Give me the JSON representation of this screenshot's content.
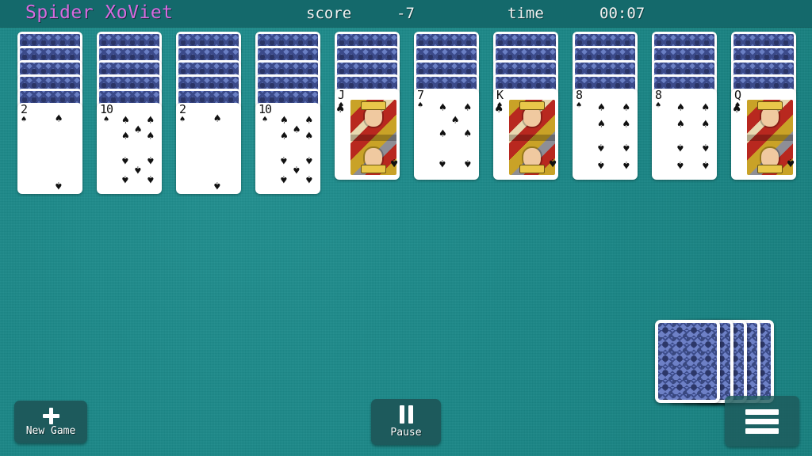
{
  "header": {
    "title": "Spider XoViet",
    "score_label": "score",
    "score_value": "-7",
    "time_label": "time",
    "time_value": "00:07"
  },
  "theme": {
    "felt_color": "#1b8a8a",
    "header_color": "#14696b",
    "title_color": "#d96ae0",
    "button_color": "#1d5a5c",
    "card_back_color": "#6d80c6"
  },
  "tableau": {
    "columns": [
      {
        "index": 1,
        "facedown_count": 5,
        "faceup": {
          "rank": "2",
          "suit": "♠",
          "pip_count": 2,
          "is_court": false
        }
      },
      {
        "index": 2,
        "facedown_count": 5,
        "faceup": {
          "rank": "10",
          "suit": "♠",
          "pip_count": 10,
          "is_court": false
        }
      },
      {
        "index": 3,
        "facedown_count": 5,
        "faceup": {
          "rank": "2",
          "suit": "♠",
          "pip_count": 2,
          "is_court": false
        }
      },
      {
        "index": 4,
        "facedown_count": 5,
        "faceup": {
          "rank": "10",
          "suit": "♠",
          "pip_count": 10,
          "is_court": false
        }
      },
      {
        "index": 5,
        "facedown_count": 4,
        "faceup": {
          "rank": "J",
          "suit": "♠",
          "pip_count": 0,
          "is_court": true
        }
      },
      {
        "index": 6,
        "facedown_count": 4,
        "faceup": {
          "rank": "7",
          "suit": "♠",
          "pip_count": 7,
          "is_court": false
        }
      },
      {
        "index": 7,
        "facedown_count": 4,
        "faceup": {
          "rank": "K",
          "suit": "♠",
          "pip_count": 0,
          "is_court": true
        }
      },
      {
        "index": 8,
        "facedown_count": 4,
        "faceup": {
          "rank": "8",
          "suit": "♠",
          "pip_count": 8,
          "is_court": false
        }
      },
      {
        "index": 9,
        "facedown_count": 4,
        "faceup": {
          "rank": "8",
          "suit": "♠",
          "pip_count": 8,
          "is_court": false
        }
      },
      {
        "index": 10,
        "facedown_count": 4,
        "faceup": {
          "rank": "Q",
          "suit": "♠",
          "pip_count": 0,
          "is_court": true
        }
      }
    ]
  },
  "stock": {
    "pile_count": 5,
    "icon": "card-back"
  },
  "controls": {
    "new_game_label": "New Game",
    "new_game_icon": "plus-icon",
    "pause_label": "Pause",
    "pause_icon": "pause-icon",
    "menu_icon": "hamburger-icon"
  }
}
